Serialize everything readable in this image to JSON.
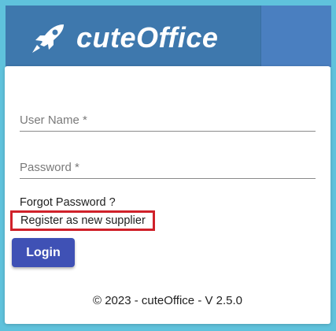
{
  "header": {
    "app_name": "cuteOffice",
    "logo_icon": "rocket-icon"
  },
  "login_form": {
    "username_placeholder": "User Name *",
    "username_value": "",
    "password_placeholder": "Password *",
    "password_value": "",
    "forgot_password_label": "Forgot Password ?",
    "register_label": "Register as new supplier",
    "login_button_label": "Login"
  },
  "footer": {
    "copyright": "© 2023 - cuteOffice - V 2.5.0"
  },
  "colors": {
    "background": "#5fc2dc",
    "header_bar": "#4a7fc0",
    "logo_block": "#3e78ad",
    "primary_button": "#3f51b5",
    "highlight_border": "#d0212a"
  }
}
